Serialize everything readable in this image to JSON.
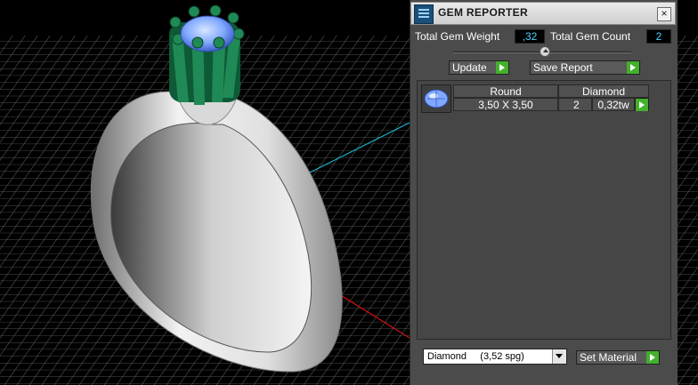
{
  "panel": {
    "title": "GEM REPORTER",
    "close_icon": "close-icon",
    "total_gem_weight_label": "Total Gem Weight",
    "total_gem_weight_value": ",32",
    "total_gem_count_label": "Total Gem Count",
    "total_gem_count_value": "2",
    "update_label": "Update",
    "save_report_label": "Save Report",
    "report": {
      "row": {
        "gem_icon": "round-gem-icon",
        "shape": "Round",
        "material": "Diamond",
        "size": "3,50 X 3,50",
        "count": "2",
        "weight": "0,32tw"
      }
    },
    "material_select": "Diamond     (3,52 spg)",
    "set_material_label": "Set Material"
  },
  "colors": {
    "panel_bg": "#4b4b4b",
    "value_text": "#4fd0ff",
    "go_button": "#44b02c",
    "prongs": "#1f8a56",
    "gem": "#7fa8ff",
    "axis_x": "#d01010",
    "axis_y": "#19b5d1"
  }
}
